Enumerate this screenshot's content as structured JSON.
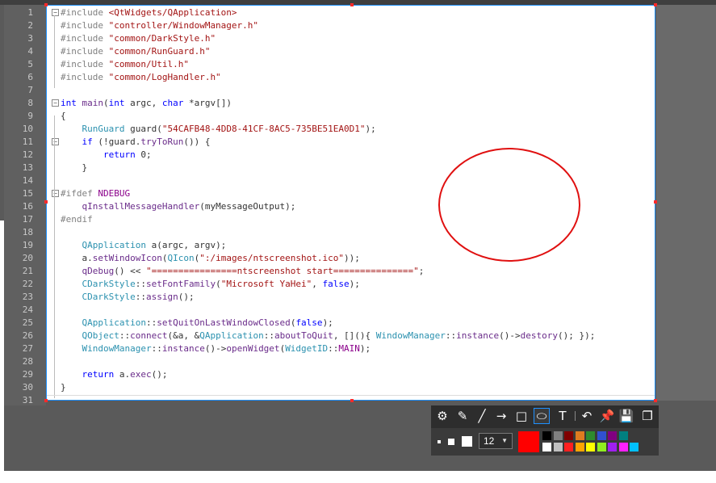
{
  "editor": {
    "lines": [
      {
        "n": "1",
        "t": [
          [
            "pp",
            "#include "
          ],
          [
            "str",
            "<QtWidgets/QApplication>"
          ]
        ]
      },
      {
        "n": "2",
        "t": [
          [
            "pp",
            "#include "
          ],
          [
            "str",
            "\"controller/WindowManager.h\""
          ]
        ]
      },
      {
        "n": "3",
        "t": [
          [
            "pp",
            "#include "
          ],
          [
            "str",
            "\"common/DarkStyle.h\""
          ]
        ]
      },
      {
        "n": "4",
        "t": [
          [
            "pp",
            "#include "
          ],
          [
            "str",
            "\"common/RunGuard.h\""
          ]
        ]
      },
      {
        "n": "5",
        "t": [
          [
            "pp",
            "#include "
          ],
          [
            "str",
            "\"common/Util.h\""
          ]
        ]
      },
      {
        "n": "6",
        "t": [
          [
            "pp",
            "#include "
          ],
          [
            "str",
            "\"common/LogHandler.h\""
          ]
        ]
      },
      {
        "n": "7",
        "t": []
      },
      {
        "n": "8",
        "t": [
          [
            "kw",
            "int "
          ],
          [
            "fn",
            "main"
          ],
          [
            "def",
            "("
          ],
          [
            "kw",
            "int "
          ],
          [
            "def",
            "argc, "
          ],
          [
            "kw",
            "char "
          ],
          [
            "def",
            "*argv[])"
          ]
        ]
      },
      {
        "n": "9",
        "t": [
          [
            "def",
            "{"
          ]
        ]
      },
      {
        "n": "10",
        "t": [
          [
            "def",
            "    "
          ],
          [
            "ty",
            "RunGuard "
          ],
          [
            "def",
            "guard("
          ],
          [
            "str",
            "\"54CAFB48-4DD8-41CF-8AC5-735BE51EA0D1\""
          ],
          [
            "def",
            ");"
          ]
        ]
      },
      {
        "n": "11",
        "t": [
          [
            "def",
            "    "
          ],
          [
            "kw",
            "if "
          ],
          [
            "def",
            "(!guard."
          ],
          [
            "fn",
            "tryToRun"
          ],
          [
            "def",
            "()) {"
          ]
        ]
      },
      {
        "n": "12",
        "t": [
          [
            "def",
            "        "
          ],
          [
            "kw",
            "return "
          ],
          [
            "def",
            "0;"
          ]
        ]
      },
      {
        "n": "13",
        "t": [
          [
            "def",
            "    }"
          ]
        ]
      },
      {
        "n": "14",
        "t": []
      },
      {
        "n": "15",
        "t": [
          [
            "pp",
            "#ifdef "
          ],
          [
            "mac",
            "NDEBUG"
          ]
        ]
      },
      {
        "n": "16",
        "t": [
          [
            "def",
            "    "
          ],
          [
            "fn",
            "qInstallMessageHandler"
          ],
          [
            "def",
            "(myMessageOutput);"
          ]
        ]
      },
      {
        "n": "17",
        "t": [
          [
            "pp",
            "#endif"
          ]
        ]
      },
      {
        "n": "18",
        "t": []
      },
      {
        "n": "19",
        "t": [
          [
            "def",
            "    "
          ],
          [
            "ty",
            "QApplication "
          ],
          [
            "def",
            "a(argc, argv);"
          ]
        ]
      },
      {
        "n": "20",
        "t": [
          [
            "def",
            "    a."
          ],
          [
            "fn",
            "setWindowIcon"
          ],
          [
            "def",
            "("
          ],
          [
            "ty",
            "QIcon"
          ],
          [
            "def",
            "("
          ],
          [
            "str",
            "\":/images/ntscreenshot.ico\""
          ],
          [
            "def",
            "));"
          ]
        ]
      },
      {
        "n": "21",
        "t": [
          [
            "def",
            "    "
          ],
          [
            "fn",
            "qDebug"
          ],
          [
            "def",
            "() << "
          ],
          [
            "str",
            "\"================ntscreenshot start===============\""
          ],
          [
            "def",
            ";"
          ]
        ]
      },
      {
        "n": "22",
        "t": [
          [
            "def",
            "    "
          ],
          [
            "ty",
            "CDarkStyle"
          ],
          [
            "def",
            "::"
          ],
          [
            "fn",
            "setFontFamily"
          ],
          [
            "def",
            "("
          ],
          [
            "str",
            "\"Microsoft YaHei\""
          ],
          [
            "def",
            ", "
          ],
          [
            "kw",
            "false"
          ],
          [
            "def",
            ");"
          ]
        ]
      },
      {
        "n": "23",
        "t": [
          [
            "def",
            "    "
          ],
          [
            "ty",
            "CDarkStyle"
          ],
          [
            "def",
            "::"
          ],
          [
            "fn",
            "assign"
          ],
          [
            "def",
            "();"
          ]
        ]
      },
      {
        "n": "24",
        "t": []
      },
      {
        "n": "25",
        "t": [
          [
            "def",
            "    "
          ],
          [
            "ty",
            "QApplication"
          ],
          [
            "def",
            "::"
          ],
          [
            "fn",
            "setQuitOnLastWindowClosed"
          ],
          [
            "def",
            "("
          ],
          [
            "kw",
            "false"
          ],
          [
            "def",
            ");"
          ]
        ]
      },
      {
        "n": "26",
        "t": [
          [
            "def",
            "    "
          ],
          [
            "ty",
            "QObject"
          ],
          [
            "def",
            "::"
          ],
          [
            "fn",
            "connect"
          ],
          [
            "def",
            "(&a, &"
          ],
          [
            "ty",
            "QApplication"
          ],
          [
            "def",
            "::"
          ],
          [
            "fn",
            "aboutToQuit"
          ],
          [
            "def",
            ", [](){ "
          ],
          [
            "ty",
            "WindowManager"
          ],
          [
            "def",
            "::"
          ],
          [
            "fn",
            "instance"
          ],
          [
            "def",
            "()->"
          ],
          [
            "fn",
            "destory"
          ],
          [
            "def",
            "(); });"
          ]
        ]
      },
      {
        "n": "27",
        "t": [
          [
            "def",
            "    "
          ],
          [
            "ty",
            "WindowManager"
          ],
          [
            "def",
            "::"
          ],
          [
            "fn",
            "instance"
          ],
          [
            "def",
            "()->"
          ],
          [
            "fn",
            "openWidget"
          ],
          [
            "def",
            "("
          ],
          [
            "ty",
            "WidgetID"
          ],
          [
            "def",
            "::"
          ],
          [
            "mac",
            "MAIN"
          ],
          [
            "def",
            ");"
          ]
        ]
      },
      {
        "n": "28",
        "t": []
      },
      {
        "n": "29",
        "t": [
          [
            "def",
            "    "
          ],
          [
            "kw",
            "return "
          ],
          [
            "def",
            "a."
          ],
          [
            "fn",
            "exec"
          ],
          [
            "def",
            "();"
          ]
        ]
      },
      {
        "n": "30",
        "t": [
          [
            "def",
            "}"
          ]
        ]
      },
      {
        "n": "31",
        "t": []
      }
    ]
  },
  "annotation": {
    "shape": "ellipse",
    "color": "#e01010"
  },
  "toolbar": {
    "tools": [
      {
        "name": "settings-icon",
        "glyph": "⚙"
      },
      {
        "name": "pen-icon",
        "glyph": "✎"
      },
      {
        "name": "line-icon",
        "glyph": "╱"
      },
      {
        "name": "arrow-icon",
        "glyph": "→"
      },
      {
        "name": "rectangle-icon",
        "glyph": "□"
      },
      {
        "name": "ellipse-icon",
        "glyph": "⬭",
        "active": true
      },
      {
        "name": "text-icon",
        "glyph": "T"
      },
      {
        "name": "undo-icon",
        "glyph": "↶"
      },
      {
        "name": "pin-icon",
        "glyph": "📌"
      },
      {
        "name": "save-icon",
        "glyph": "💾"
      },
      {
        "name": "copy-icon",
        "glyph": "❐"
      }
    ],
    "font_size": "12",
    "current_color": "#ff0000",
    "palette": [
      "#000000",
      "#808080",
      "#800000",
      "#e07b20",
      "#2e8b2e",
      "#3050d0",
      "#800080",
      "#008080",
      "#ffffff",
      "#c0c0c0",
      "#ff2020",
      "#ffa500",
      "#ffff00",
      "#90ee20",
      "#a020f0",
      "#ff20ff",
      "#00c0ff"
    ]
  }
}
